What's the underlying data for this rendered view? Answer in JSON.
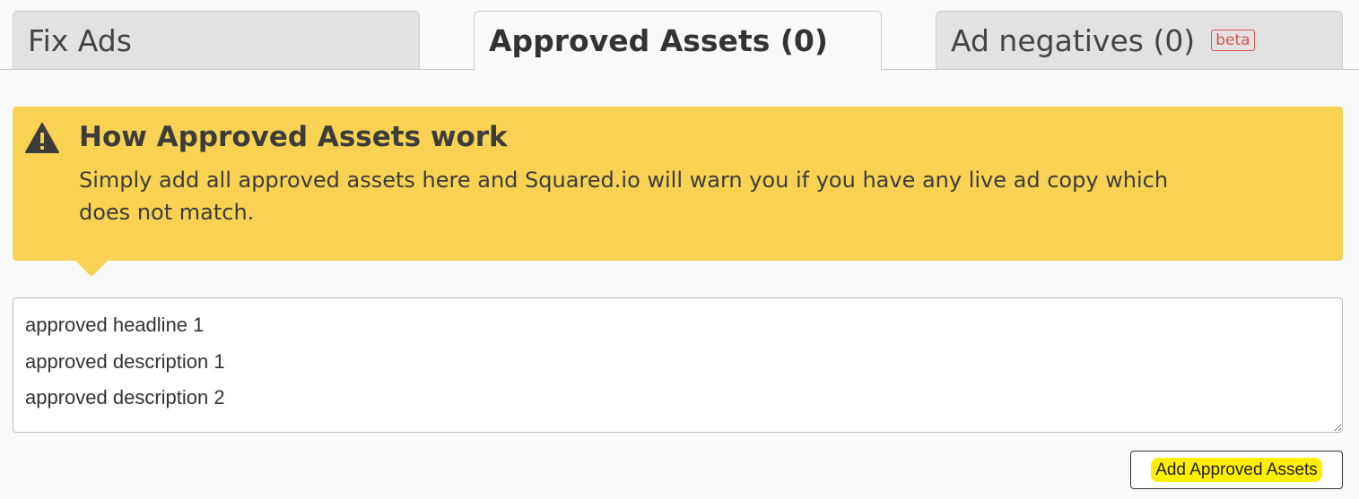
{
  "tabs": [
    {
      "label": "Fix Ads",
      "active": false
    },
    {
      "label": "Approved Assets (0)",
      "active": true
    },
    {
      "label": "Ad negatives (0)",
      "badge": "beta",
      "active": false
    }
  ],
  "alert": {
    "icon": "warning-icon",
    "title": "How Approved Assets work",
    "body": "Simply add all approved assets here and Squared.io will warn you if you have any live ad copy which does not match.",
    "background_color": "#f8d253"
  },
  "assets_input": {
    "value": "approved headline 1\napproved description 1\napproved description 2"
  },
  "add_button": {
    "label": "Add Approved Assets",
    "highlight_color": "#ffee00"
  },
  "colors": {
    "badge_red": "#d9534f",
    "tab_inactive_bg": "#e2e2e2"
  }
}
